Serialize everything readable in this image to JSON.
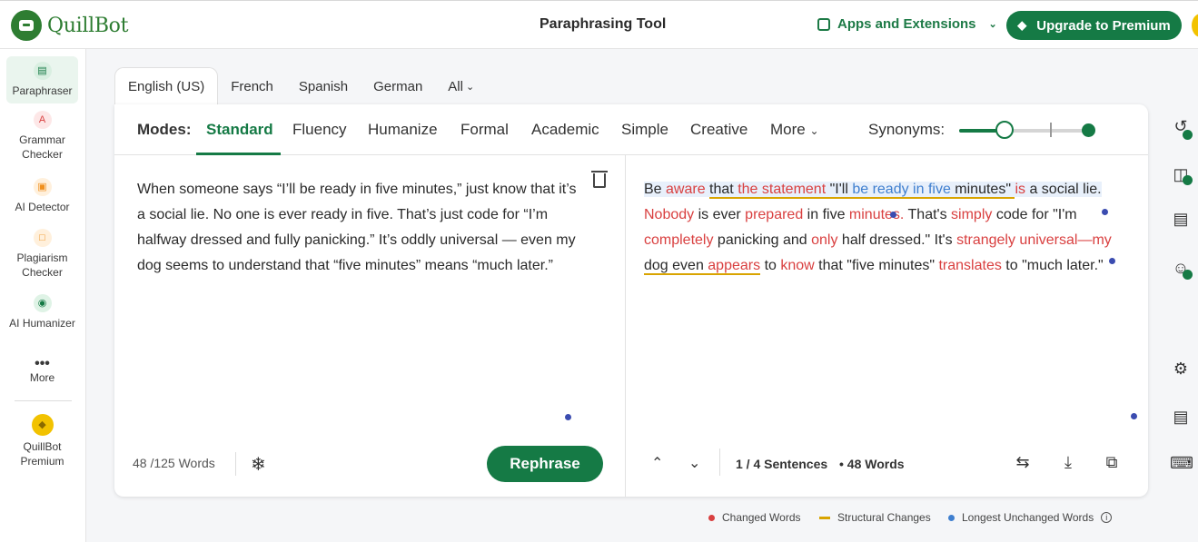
{
  "header": {
    "logo_text": "QuillBot",
    "page_title": "Paraphrasing Tool",
    "apps_label": "Apps and Extensions",
    "upgrade_label": "Upgrade to Premium"
  },
  "sidebar": {
    "items": [
      {
        "label": "Paraphraser",
        "icon": "paraphraser-icon"
      },
      {
        "label": "Grammar Checker",
        "icon": "grammar-icon"
      },
      {
        "label": "AI Detector",
        "icon": "ai-detector-icon"
      },
      {
        "label": "Plagiarism Checker",
        "icon": "plagiarism-icon"
      },
      {
        "label": "AI Humanizer",
        "icon": "humanizer-icon"
      },
      {
        "label": "More",
        "icon": "more-icon"
      },
      {
        "label": "QuillBot Premium",
        "icon": "premium-icon"
      }
    ]
  },
  "languages": [
    "English (US)",
    "French",
    "Spanish",
    "German",
    "All"
  ],
  "modes": {
    "label": "Modes:",
    "items": [
      "Standard",
      "Fluency",
      "Humanize",
      "Formal",
      "Academic",
      "Simple",
      "Creative",
      "More"
    ],
    "active": "Standard",
    "synonyms_label": "Synonyms:",
    "synonyms_level": 0.35
  },
  "input": {
    "text": "When someone says “I’ll be ready in five minutes,” just know that it’s a social lie. No one is ever ready in five. That’s just code for “I’m halfway dressed and fully panicking.” It’s oddly universal — even my dog seems to understand that “five minutes” means “much later.”",
    "word_count": "48 /125 Words",
    "rephrase_label": "Rephrase"
  },
  "output": {
    "segments": [
      {
        "t": "Be ",
        "k": "n",
        "hl": true
      },
      {
        "t": "aware",
        "k": "c",
        "hl": true
      },
      {
        "t": " ",
        "k": "n",
        "hl": true
      },
      {
        "t": "that ",
        "k": "n",
        "hl": true,
        "s": true
      },
      {
        "t": "the statement",
        "k": "c",
        "hl": true,
        "s": true
      },
      {
        "t": " \"I'll ",
        "k": "n",
        "hl": true,
        "s": true
      },
      {
        "t": "be ready in five",
        "k": "u",
        "hl": true,
        "s": true
      },
      {
        "t": " minutes\" ",
        "k": "n",
        "hl": true,
        "s": true
      },
      {
        "t": "is",
        "k": "c",
        "hl": true
      },
      {
        "t": " a social lie. ",
        "k": "n",
        "hl": true
      },
      {
        "t": "Nobody",
        "k": "c"
      },
      {
        "t": " is ever ",
        "k": "n"
      },
      {
        "t": "prepared",
        "k": "c"
      },
      {
        "t": " in five ",
        "k": "n"
      },
      {
        "t": "minutes.",
        "k": "c"
      },
      {
        "t": " That's ",
        "k": "n"
      },
      {
        "t": "simply",
        "k": "c"
      },
      {
        "t": " code for \"I'm ",
        "k": "n"
      },
      {
        "t": "completely",
        "k": "c"
      },
      {
        "t": " panicking and ",
        "k": "n"
      },
      {
        "t": "only",
        "k": "c"
      },
      {
        "t": " half dressed.\" It's ",
        "k": "n"
      },
      {
        "t": "strangely universal—my",
        "k": "c"
      },
      {
        "t": " ",
        "k": "n"
      },
      {
        "t": "dog even ",
        "k": "n",
        "s": true
      },
      {
        "t": "appears",
        "k": "c",
        "s": true
      },
      {
        "t": " ",
        "k": "n"
      },
      {
        "t": "to",
        "k": "n"
      },
      {
        "t": " ",
        "k": "n"
      },
      {
        "t": "know",
        "k": "c"
      },
      {
        "t": " that \"five minutes\" ",
        "k": "n"
      },
      {
        "t": "translates",
        "k": "c"
      },
      {
        "t": " to \"much later.\"",
        "k": "n"
      }
    ],
    "sentences": "1 / 4 Sentences",
    "words": "• 48 Words"
  },
  "legend": {
    "changed": "Changed Words",
    "structural": "Structural Changes",
    "unchanged": "Longest Unchanged Words"
  },
  "colors": {
    "brand": "#157a45",
    "changed": "#d94040",
    "structural": "#d9a400",
    "unchanged": "#3f7fcf"
  }
}
